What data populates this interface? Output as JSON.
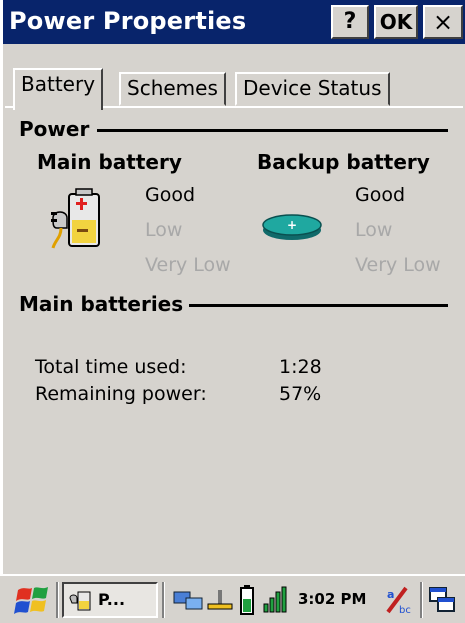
{
  "window": {
    "title": "Power Properties",
    "help_label": "?",
    "ok_label": "OK",
    "close_label": "×"
  },
  "tabs": [
    {
      "label": "Battery",
      "active": true
    },
    {
      "label": "Schemes",
      "active": false
    },
    {
      "label": "Device Status",
      "active": false
    }
  ],
  "power": {
    "heading": "Power",
    "main_battery": {
      "title": "Main battery",
      "levels": [
        "Good",
        "Low",
        "Very Low"
      ],
      "current": "Good"
    },
    "backup_battery": {
      "title": "Backup battery",
      "levels": [
        "Good",
        "Low",
        "Very Low"
      ],
      "current": "Good"
    }
  },
  "main_batteries": {
    "heading": "Main batteries",
    "rows": [
      {
        "label": "Total time used:",
        "value": "1:28"
      },
      {
        "label": "Remaining power:",
        "value": "57%"
      }
    ]
  },
  "taskbar": {
    "task_label": "P...",
    "clock": "3:02 PM",
    "icons": [
      "start-icon",
      "power-task-icon",
      "network-icon",
      "battery-icon",
      "signal-icon",
      "input-panel-icon",
      "desktop-icon"
    ]
  },
  "colors": {
    "titlebar": "#08246b",
    "face": "#d6d3ce",
    "disabled_text": "#a8a8a8"
  }
}
